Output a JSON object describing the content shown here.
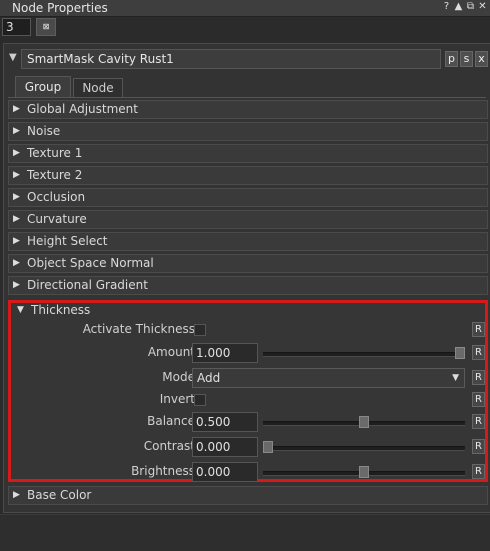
{
  "window": {
    "title": "Node Properties",
    "icons": [
      "question-icon",
      "maximize-icon",
      "float-icon",
      "close-icon"
    ],
    "icon_glyphs": [
      "?",
      "▲",
      "⧉",
      "✕"
    ]
  },
  "toolbar": {
    "count_value": "3",
    "float_label": "⊠"
  },
  "node": {
    "name": "SmartMask Cavity Rust1",
    "buttons": [
      "p",
      "s",
      "x"
    ],
    "collapse_glyph": "▼"
  },
  "tabs": [
    {
      "label": "Group",
      "active": true
    },
    {
      "label": "Node",
      "active": false
    }
  ],
  "sections": [
    {
      "label": "Global Adjustment"
    },
    {
      "label": "Noise"
    },
    {
      "label": "Texture 1"
    },
    {
      "label": "Texture 2"
    },
    {
      "label": "Occlusion"
    },
    {
      "label": "Curvature"
    },
    {
      "label": "Height Select"
    },
    {
      "label": "Object Space Normal"
    },
    {
      "label": "Directional Gradient"
    }
  ],
  "thickness": {
    "title": "Thickness",
    "highlight_color": "#d61a1a",
    "params": [
      {
        "label": "Activate Thickness",
        "type": "checkbox",
        "checked": false,
        "reset": "R"
      },
      {
        "label": "Amount",
        "type": "slider",
        "value": "1.000",
        "fraction": 1.0,
        "reset": "R"
      },
      {
        "label": "Mode",
        "type": "select",
        "value": "Add",
        "reset": "R"
      },
      {
        "label": "Invert",
        "type": "checkbox",
        "checked": false,
        "reset": "R"
      },
      {
        "label": "Balance",
        "type": "slider",
        "value": "0.500",
        "fraction": 0.5,
        "reset": "R"
      },
      {
        "label": "Contrast",
        "type": "slider",
        "value": "0.000",
        "fraction": 0.0,
        "reset": "R"
      },
      {
        "label": "Brightness",
        "type": "slider",
        "value": "0.000",
        "fraction": 0.5,
        "reset": "R"
      }
    ]
  },
  "after_sections": [
    {
      "label": "Base Color"
    }
  ]
}
